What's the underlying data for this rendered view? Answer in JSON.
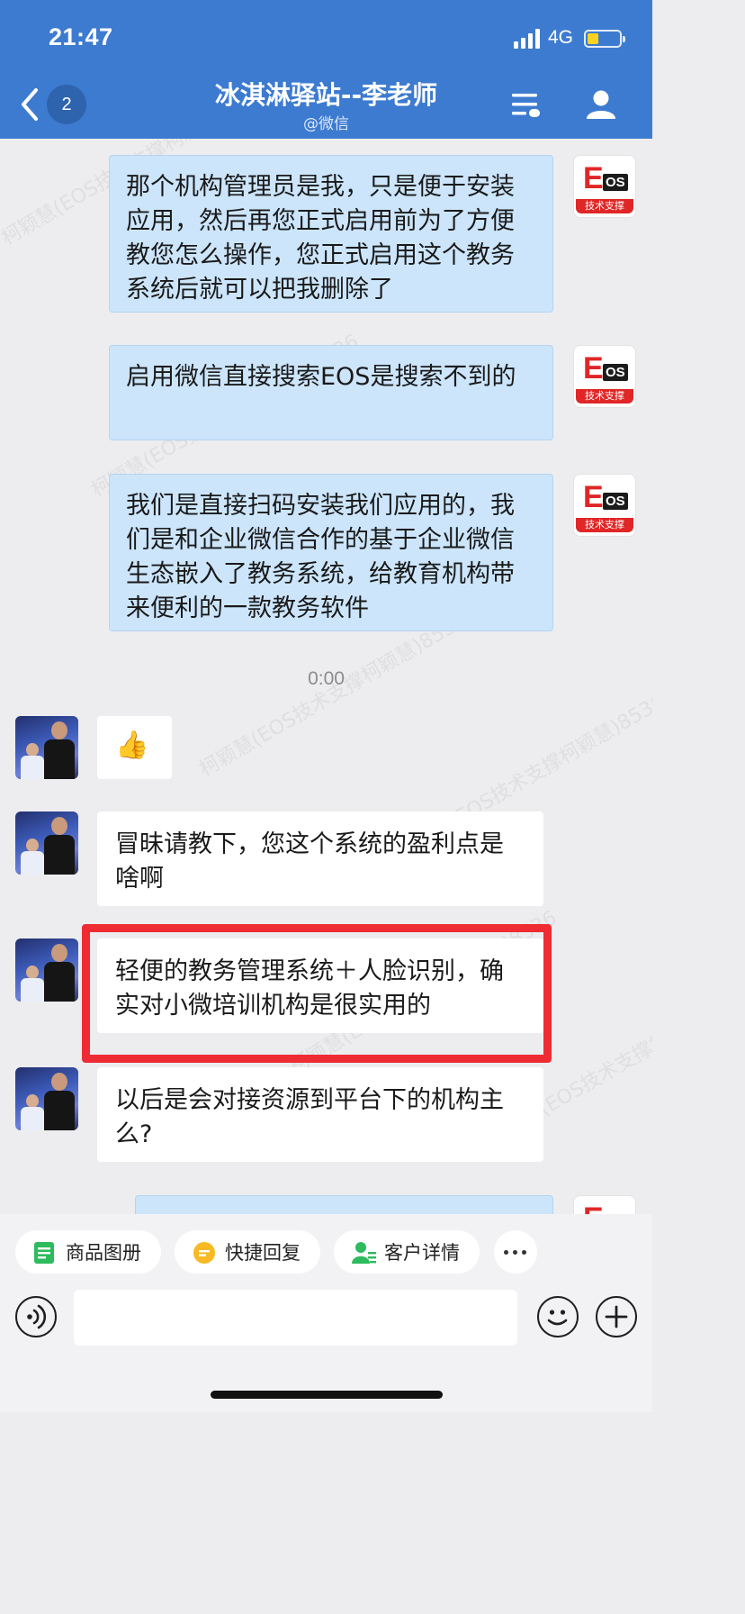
{
  "status_bar": {
    "time": "21:47",
    "network": "4G",
    "battery_level": 0.35,
    "battery_color": "#ffd21f"
  },
  "header": {
    "unread_count": "2",
    "title": "冰淇淋驿站--李老师",
    "subtitle": "@微信",
    "background": "#3d7bd0"
  },
  "watermark_text": "柯颖慧(EOS技术支撑柯颖慧)8536",
  "eos_avatar": {
    "logo_letter": "E",
    "logo_os": "OS",
    "tag": "技术支撑"
  },
  "messages": [
    {
      "side": "out",
      "text": "那个机构管理员是我，只是便于安装应用，然后再您正式启用前为了方便教您怎么操作，您正式启用这个教务系统后就可以把我删除了"
    },
    {
      "side": "out",
      "text": "启用微信直接搜索EOS是搜索不到的"
    },
    {
      "side": "out",
      "text": "我们是直接扫码安装我们应用的，我们是和企业微信合作的基于企业微信生态嵌入了教务系统，给教育机构带来便利的一款教务软件"
    },
    {
      "side": "time",
      "text": "0:00"
    },
    {
      "side": "in",
      "text": "👍"
    },
    {
      "side": "in",
      "text": "冒昧请教下，您这个系统的盈利点是啥啊"
    },
    {
      "side": "in",
      "text": "轻便的教务管理系统＋人脸识别，确实对小微培训机构是很实用的",
      "highlighted": true
    },
    {
      "side": "in",
      "text": "以后是会对接资源到平台下的机构主么?"
    }
  ],
  "quick_actions": [
    {
      "label": "商品图册",
      "icon": "product-album-icon",
      "color": "#2dbb5d"
    },
    {
      "label": "快捷回复",
      "icon": "quick-reply-icon",
      "color": "#f7b924"
    },
    {
      "label": "客户详情",
      "icon": "customer-detail-icon",
      "color": "#2dbb5d"
    }
  ],
  "input": {
    "value": "",
    "placeholder": ""
  },
  "highlight_color": "#ef2b33"
}
